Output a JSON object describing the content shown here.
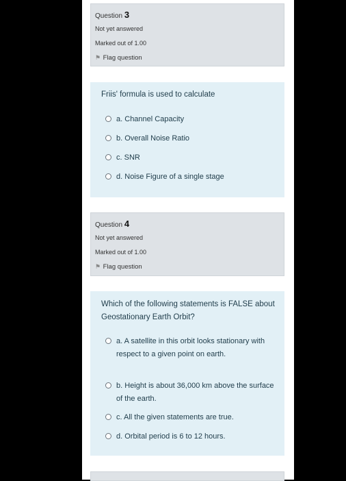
{
  "questions": [
    {
      "label": "Question",
      "number": "3",
      "status": "Not yet answered",
      "marks": "Marked out of 1.00",
      "flag": "Flag question",
      "text": "Friis' formula is used to calculate",
      "options": [
        {
          "letter": "a.",
          "text": "Channel Capacity"
        },
        {
          "letter": "b.",
          "text": "Overall Noise Ratio"
        },
        {
          "letter": "c.",
          "text": "SNR"
        },
        {
          "letter": "d.",
          "text": "Noise Figure of a single stage"
        }
      ]
    },
    {
      "label": "Question",
      "number": "4",
      "status": "Not yet answered",
      "marks": "Marked out of 1.00",
      "flag": "Flag question",
      "text": "Which of the following statements is FALSE about Geostationary Earth Orbit?",
      "options": [
        {
          "letter": "a.",
          "text": "A satellite in this orbit looks stationary with respect to a given point on earth."
        },
        {
          "letter": "b.",
          "text": "Height is about 36,000 km above the surface of the earth."
        },
        {
          "letter": "c.",
          "text": "All the given statements are true."
        },
        {
          "letter": "d.",
          "text": "Orbital period is 6 to 12 hours."
        }
      ]
    }
  ],
  "icons": {
    "flag": "flag-icon",
    "radio": "radio-button-icon"
  },
  "colors": {
    "info_bg": "#dee2e6",
    "content_bg": "#e2f0f6",
    "text": "#1f3c4a"
  }
}
